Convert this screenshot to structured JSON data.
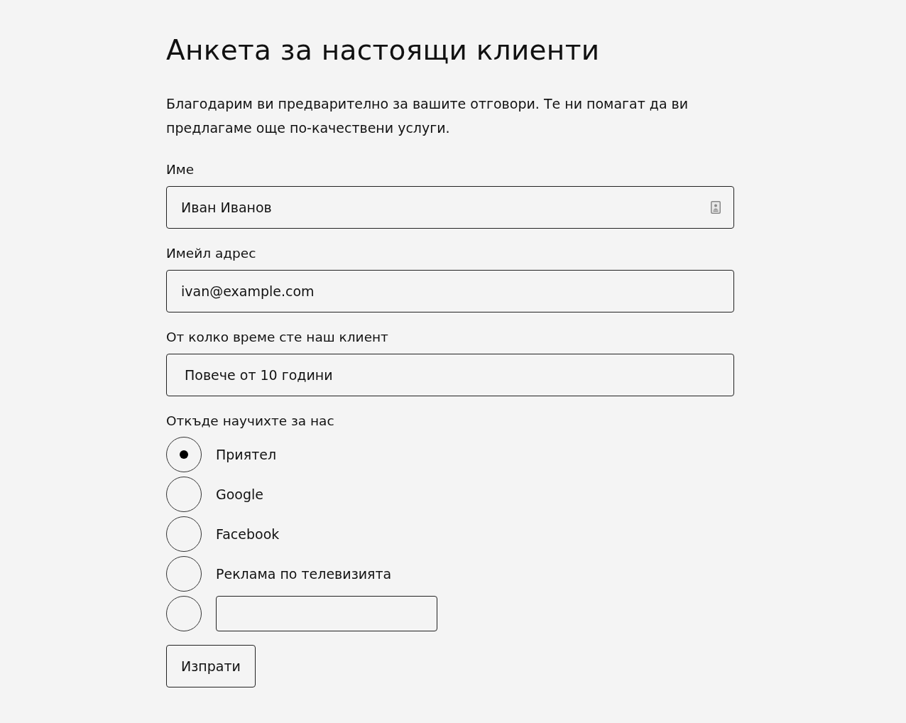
{
  "title": "Анкета за настоящи клиенти",
  "intro": "Благодарим ви предварително за вашите отговори. Те ни помагат да ви предлагаме още по-качествени услуги.",
  "fields": [
    {
      "kind": "text",
      "label": "Име",
      "value": "Иван Иванов",
      "autofill": true
    },
    {
      "kind": "text",
      "label": "Имейл адрес",
      "value": "ivan@example.com",
      "autofill": false
    },
    {
      "kind": "select",
      "label": "От колко време сте наш клиент",
      "value": "Повече от 10 години"
    }
  ],
  "source": {
    "label": "Откъде научихте за нас",
    "options": [
      {
        "kind": "text",
        "label": "Приятел",
        "selected": true
      },
      {
        "kind": "text",
        "label": "Google",
        "selected": false
      },
      {
        "kind": "text",
        "label": "Facebook",
        "selected": false
      },
      {
        "kind": "text",
        "label": "Реклама по телевизията",
        "selected": false
      },
      {
        "kind": "other",
        "selected": false
      }
    ]
  },
  "submit": "Изпрати"
}
